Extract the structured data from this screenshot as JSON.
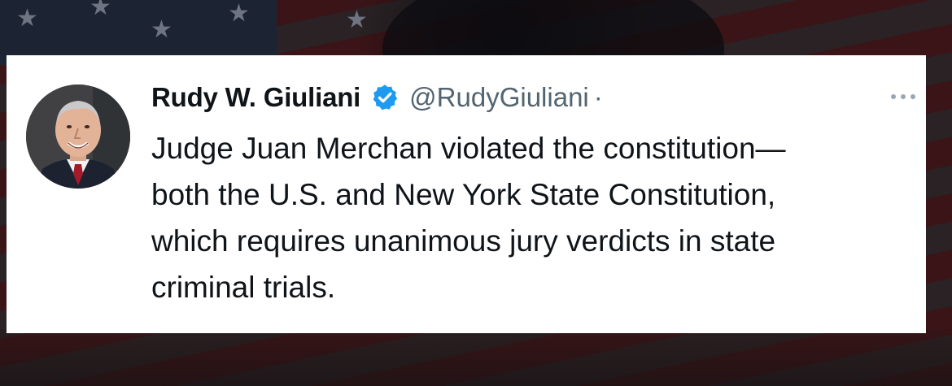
{
  "tweet": {
    "display_name": "Rudy W. Giuliani",
    "handle": "@RudyGiuliani",
    "separator": "·",
    "verified_badge_icon": "verified-badge-icon",
    "more_icon": "more-options-icon",
    "text": "Judge Juan Merchan violated the constitution—\nboth the U.S. and New York State Constitution,\nwhich requires unanimous jury verdicts in state\ncriminal trials."
  },
  "colors": {
    "text_primary": "#0f1419",
    "text_secondary": "#536471",
    "verified_blue": "#1d9bf0",
    "card_background": "#ffffff"
  }
}
